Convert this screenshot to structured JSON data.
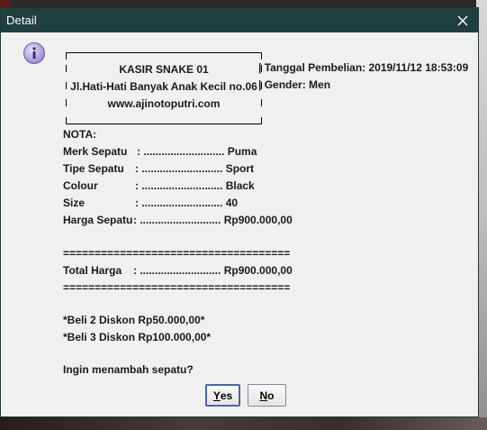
{
  "window": {
    "title": "Detail"
  },
  "store": {
    "name": "KASIR SNAKE 01",
    "address": "Jl.Hati-Hati Banyak Anak Kecil no.06",
    "website": "www.ajinotoputri.com"
  },
  "purchase": {
    "date_line": "| Tanggal Pembelian: 2019/11/12 18:53:09",
    "gender_line": "| Gender: Men"
  },
  "nota": {
    "heading": "NOTA:",
    "rows": [
      {
        "label": "Merk Sepatu",
        "sep": ": ...........................",
        "value": "Puma"
      },
      {
        "label": "Tipe Sepatu",
        "sep": ": ...........................",
        "value": "Sport"
      },
      {
        "label": "Colour",
        "sep": ": ...........................",
        "value": "Black"
      },
      {
        "label": "Size",
        "sep": ": ...........................",
        "value": "40"
      },
      {
        "label": "Harga Sepatu",
        "sep": ": ...........................",
        "value": "Rp900.000,00"
      }
    ],
    "separator": "====================================",
    "total_label": "Total Harga",
    "total_sep": ": ...........................",
    "total_value": "Rp900.000,00"
  },
  "discounts": [
    "*Beli 2 Diskon Rp50.000,00*",
    "*Beli 3 Diskon Rp100.000,00*"
  ],
  "question": "Ingin menambah sepatu?",
  "buttons": {
    "yes_mnemonic": "Y",
    "yes_rest": "es",
    "no_mnemonic": "N",
    "no_rest": "o"
  },
  "icons": {
    "dialog": "info-icon",
    "close": "close-icon"
  },
  "colors": {
    "titlebar": "#1f3f3f",
    "dialog_bg": "#f0f0f0",
    "info_icon": "#9a8ad0"
  }
}
